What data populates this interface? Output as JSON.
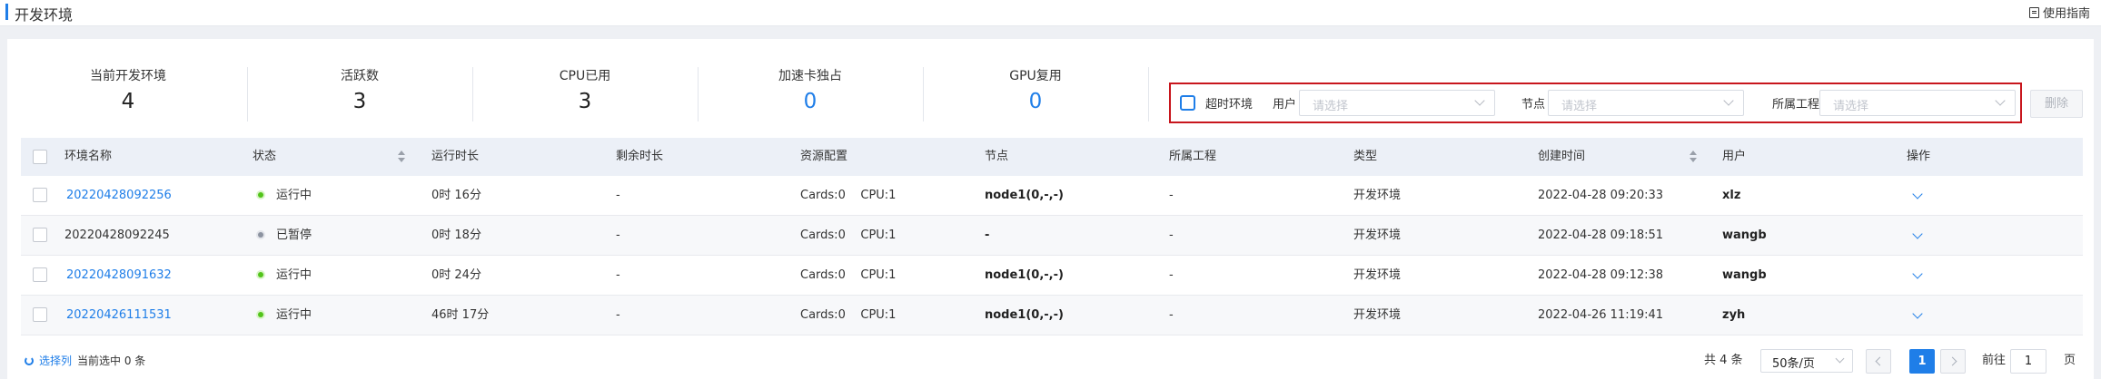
{
  "header": {
    "title": "开发环境",
    "guide_label": "使用指南"
  },
  "stats": [
    {
      "label": "当前开发环境",
      "value": "4",
      "highlight": false
    },
    {
      "label": "活跃数",
      "value": "3",
      "highlight": false
    },
    {
      "label": "CPU已用",
      "value": "3",
      "highlight": false
    },
    {
      "label": "加速卡独占",
      "value": "0",
      "highlight": true
    },
    {
      "label": "GPU复用",
      "value": "0",
      "highlight": true
    }
  ],
  "filters": {
    "timeout_label": "超时环境",
    "user_label": "用户",
    "user_placeholder": "请选择",
    "node_label": "节点",
    "node_placeholder": "请选择",
    "project_label": "所属工程",
    "project_placeholder": "请选择",
    "delete_label": "删除"
  },
  "table": {
    "columns": [
      "环境名称",
      "状态",
      "运行时长",
      "剩余时长",
      "资源配置",
      "节点",
      "所属工程",
      "类型",
      "创建时间",
      "用户",
      "操作"
    ],
    "rows": [
      {
        "name": "20220428092256",
        "status": "运行中",
        "status_kind": "running",
        "runtime": "0时 16分",
        "remaining": "-",
        "resource": "Cards:0    CPU:1",
        "node": "node1(0,-,-)",
        "project": "-",
        "type": "开发环境",
        "created": "2022-04-28 09:20:33",
        "user": "xlz"
      },
      {
        "name": "20220428092245",
        "status": "已暂停",
        "status_kind": "paused",
        "runtime": "0时 18分",
        "remaining": "-",
        "resource": "Cards:0    CPU:1",
        "node": "-",
        "project": "-",
        "type": "开发环境",
        "created": "2022-04-28 09:18:51",
        "user": "wangb"
      },
      {
        "name": "20220428091632",
        "status": "运行中",
        "status_kind": "running",
        "runtime": "0时 24分",
        "remaining": "-",
        "resource": "Cards:0    CPU:1",
        "node": "node1(0,-,-)",
        "project": "-",
        "type": "开发环境",
        "created": "2022-04-28 09:12:38",
        "user": "wangb"
      },
      {
        "name": "20220426111531",
        "status": "运行中",
        "status_kind": "running",
        "runtime": "46时 17分",
        "remaining": "-",
        "resource": "Cards:0    CPU:1",
        "node": "node1(0,-,-)",
        "project": "-",
        "type": "开发环境",
        "created": "2022-04-26 11:19:41",
        "user": "zyh"
      }
    ]
  },
  "footer": {
    "select_columns": "选择列",
    "selected_text": "当前选中 0 条",
    "total": "共 4 条",
    "page_size": "50条/页",
    "current_page": "1",
    "goto_label": "前往",
    "goto_value": "1",
    "page_suffix": "页"
  },
  "colors": {
    "accent": "#1f7ee8",
    "running": "#52c41a",
    "paused": "#8c93a0",
    "highlight_border": "#c8161d"
  }
}
